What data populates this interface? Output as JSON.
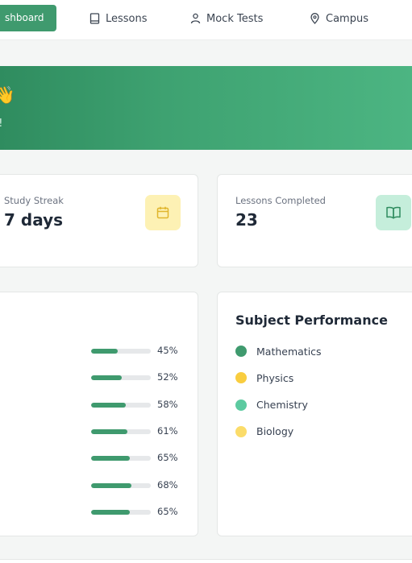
{
  "nav": {
    "active": {
      "label": "shboard"
    },
    "items": [
      {
        "label": "Lessons",
        "icon": "book-icon"
      },
      {
        "label": "Mock Tests",
        "icon": "user-icon"
      },
      {
        "label": "Campus",
        "icon": "location-pin-icon"
      }
    ]
  },
  "hero": {
    "title_fragment": "!",
    "title_emoji": "👋",
    "subtitle_fragment": "p!"
  },
  "stats": {
    "streak": {
      "label": "Study Streak",
      "value": "7 days",
      "icon": "calendar-icon"
    },
    "lessons": {
      "label": "Lessons Completed",
      "value": "23",
      "icon": "book-open-icon"
    }
  },
  "progress": {
    "rows": [
      {
        "percent": 45,
        "label": "45%"
      },
      {
        "percent": 52,
        "label": "52%"
      },
      {
        "percent": 58,
        "label": "58%"
      },
      {
        "percent": 61,
        "label": "61%"
      },
      {
        "percent": 65,
        "label": "65%"
      },
      {
        "percent": 68,
        "label": "68%"
      },
      {
        "percent": 65,
        "label": "65%"
      }
    ]
  },
  "subjects": {
    "title": "Subject Performance",
    "items": [
      {
        "label": "Mathematics",
        "color": "#3f9a6e"
      },
      {
        "label": "Physics",
        "color": "#f9cd3f"
      },
      {
        "label": "Chemistry",
        "color": "#5ccaa0"
      },
      {
        "label": "Biology",
        "color": "#fbdc6a"
      }
    ]
  },
  "colors": {
    "brand": "#3f9a6e",
    "hero_gradient_start": "#2f8c5f",
    "hero_gradient_end": "#4cb582"
  }
}
